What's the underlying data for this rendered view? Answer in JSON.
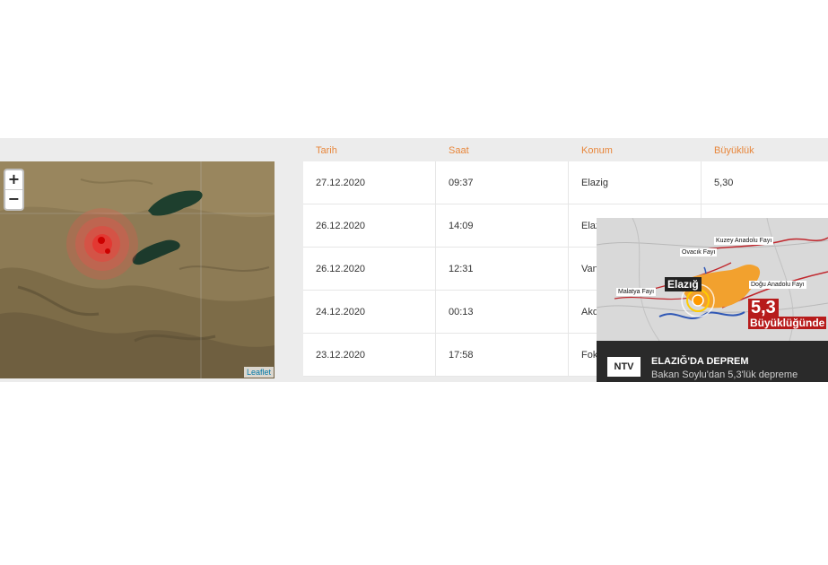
{
  "map": {
    "zoom_in": "+",
    "zoom_out": "−",
    "attribution": "Leaflet"
  },
  "table": {
    "headers": [
      "Tarih",
      "Saat",
      "Konum",
      "Büyüklük"
    ],
    "rows": [
      {
        "date": "27.12.2020",
        "time": "09:37",
        "location": "Elazig",
        "magnitude": "5,30"
      },
      {
        "date": "26.12.2020",
        "time": "14:09",
        "location": "Elaz",
        "magnitude": ""
      },
      {
        "date": "26.12.2020",
        "time": "12:31",
        "location": "Van",
        "magnitude": ""
      },
      {
        "date": "24.12.2020",
        "time": "00:13",
        "location": "Akd",
        "magnitude": ""
      },
      {
        "date": "23.12.2020",
        "time": "17:58",
        "location": "Fok",
        "magnitude": ""
      }
    ]
  },
  "news": {
    "fault_labels": [
      "Kuzey Anadolu Fayı",
      "Ovacık Fayı",
      "Doğu Anadolu Fayı",
      "Malatya Fayı"
    ],
    "city": "Elazığ",
    "magnitude": "5,3",
    "magnitude_sub": "Büyüklüğünde",
    "channel_logo": "NTV",
    "headline": "ELAZIĞ'DA DEPREM",
    "subline": "Bakan Soylu'dan 5,3'lük depreme"
  }
}
